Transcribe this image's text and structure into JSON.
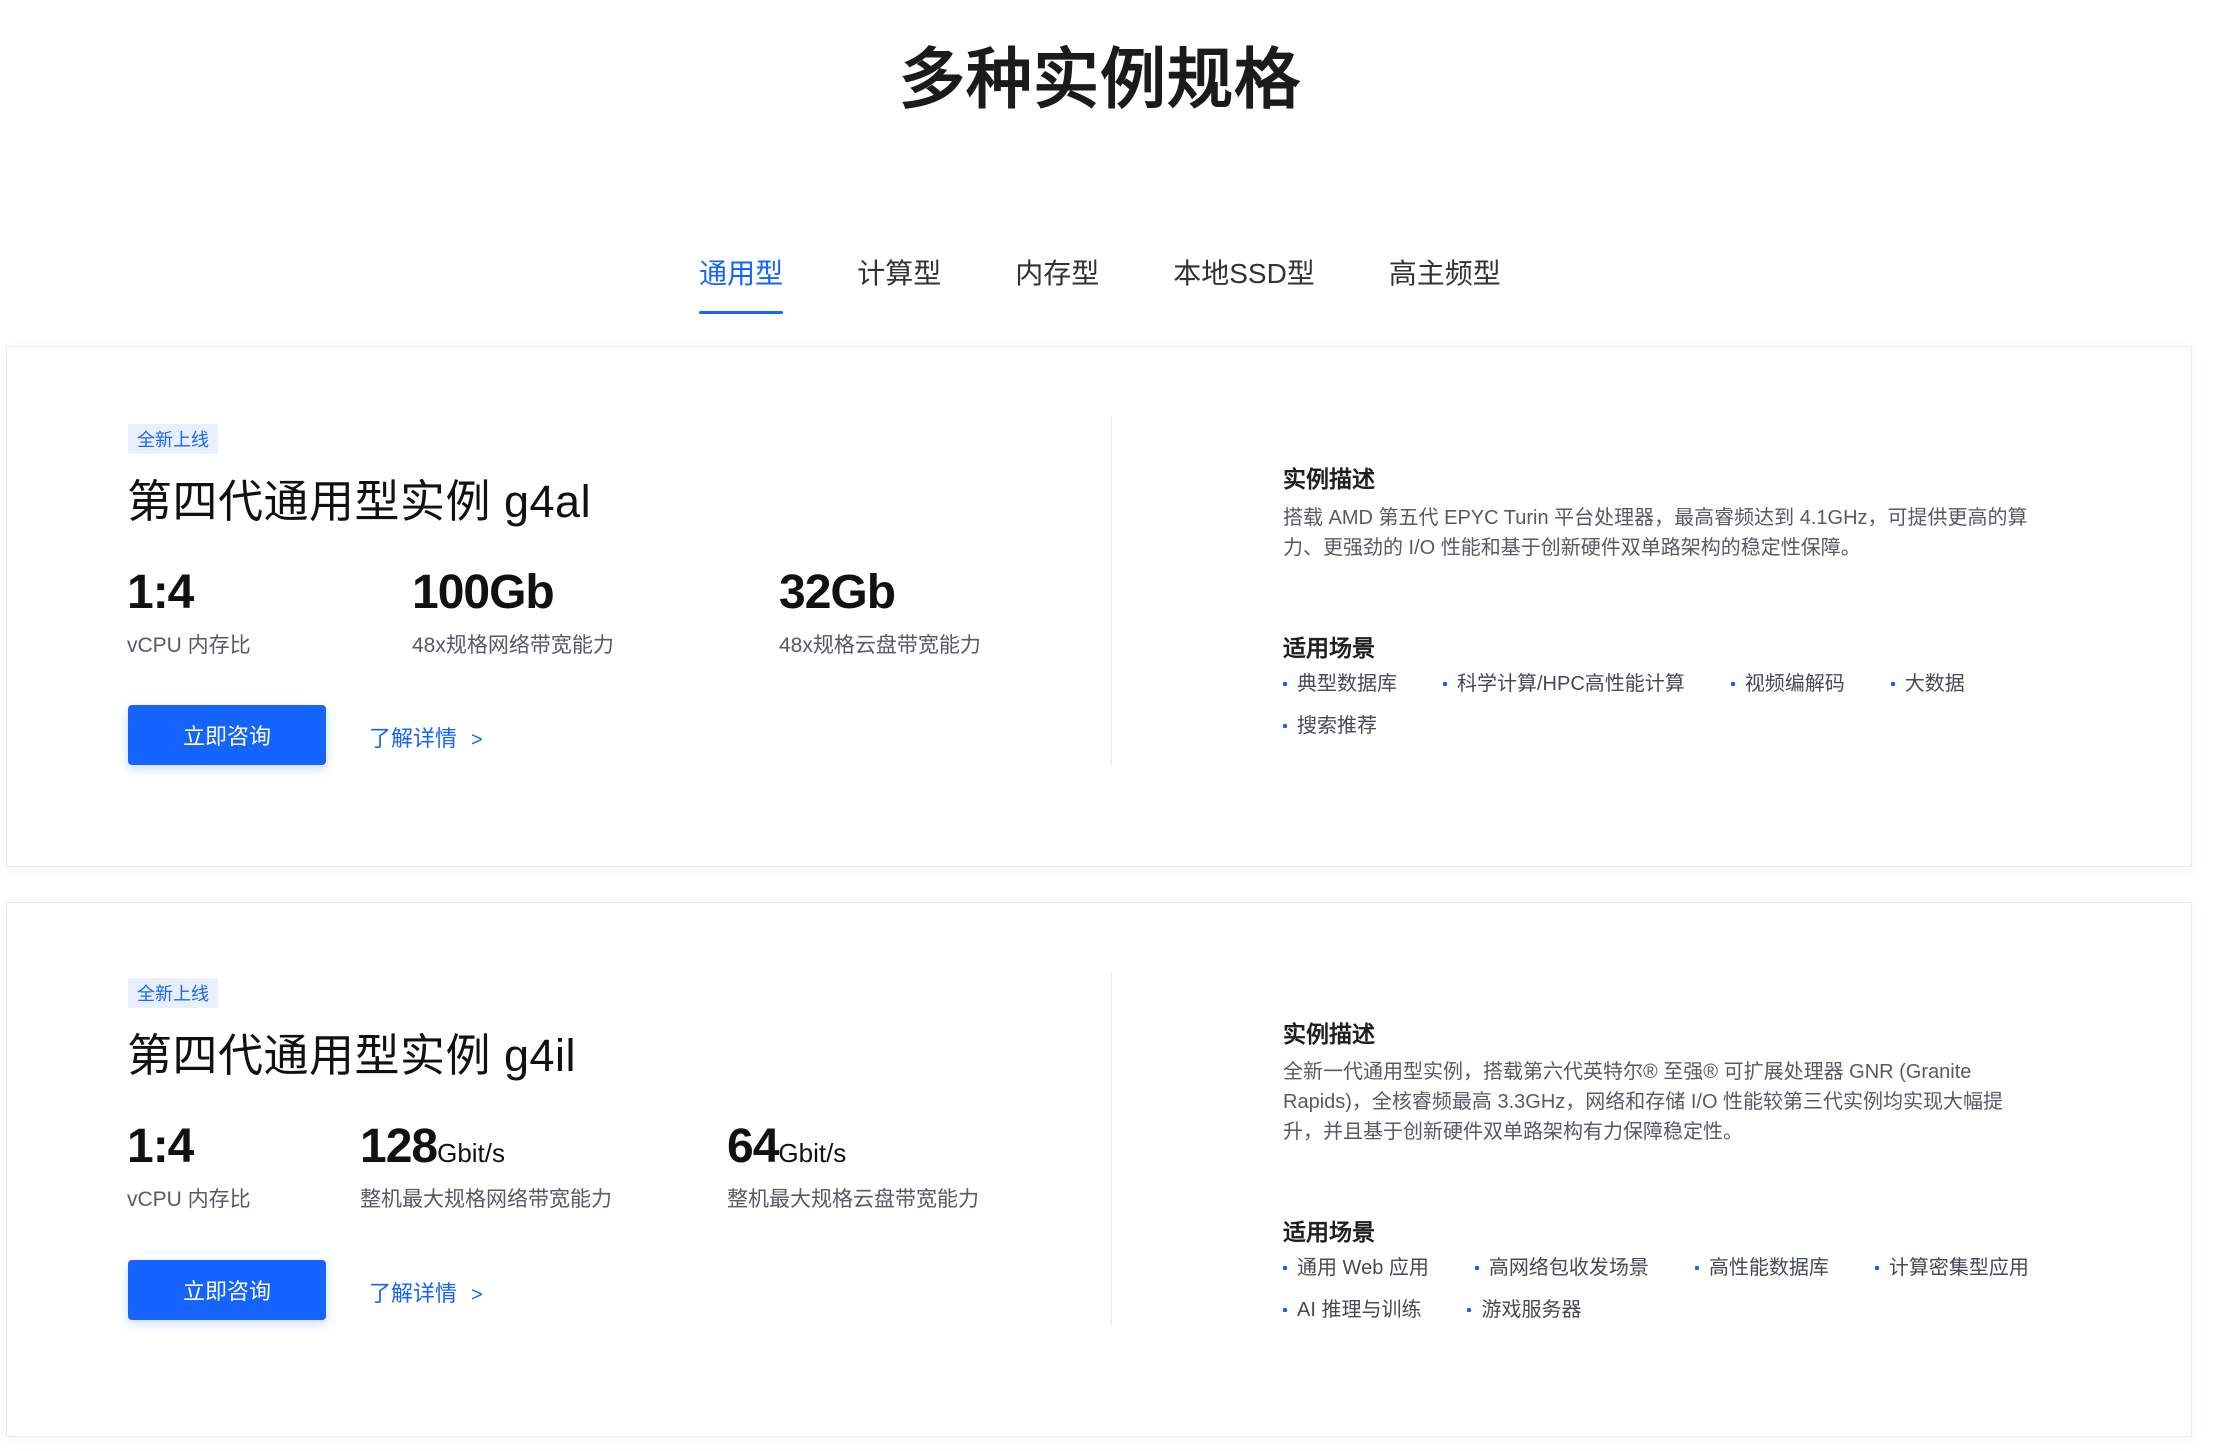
{
  "page_title": "多种实例规格",
  "tabs": [
    {
      "label": "通用型",
      "active": true
    },
    {
      "label": "计算型",
      "active": false
    },
    {
      "label": "内存型",
      "active": false
    },
    {
      "label": "本地SSD型",
      "active": false
    },
    {
      "label": "高主频型",
      "active": false
    }
  ],
  "cards": [
    {
      "badge": "全新上线",
      "title": "第四代通用型实例 g4al",
      "stats": [
        {
          "value": "1:4",
          "unit": "",
          "label": "vCPU 内存比"
        },
        {
          "value": "100Gb",
          "unit": "",
          "label": "48x规格网络带宽能力"
        },
        {
          "value": "32Gb",
          "unit": "",
          "label": "48x规格云盘带宽能力"
        }
      ],
      "consult_label": "立即咨询",
      "more_label": "了解详情",
      "more_arrow": ">",
      "desc_title": "实例描述",
      "desc_text": "搭载 AMD 第五代 EPYC Turin 平台处理器，最高睿频达到 4.1GHz，可提供更高的算力、更强劲的 I/O 性能和基于创新硬件双单路架构的稳定性保障。",
      "scene_title": "适用场景",
      "scenes": [
        "典型数据库",
        "科学计算/HPC高性能计算",
        "视频编解码",
        "大数据",
        "搜索推荐"
      ]
    },
    {
      "badge": "全新上线",
      "title": "第四代通用型实例 g4il",
      "stats": [
        {
          "value": "1:4",
          "unit": "",
          "label": "vCPU 内存比"
        },
        {
          "value": "128",
          "unit": "Gbit/s",
          "label": "整机最大规格网络带宽能力"
        },
        {
          "value": "64",
          "unit": "Gbit/s",
          "label": "整机最大规格云盘带宽能力"
        }
      ],
      "consult_label": "立即咨询",
      "more_label": "了解详情",
      "more_arrow": ">",
      "desc_title": "实例描述",
      "desc_text": "全新一代通用型实例，搭载第六代英特尔® 至强® 可扩展处理器 GNR (Granite Rapids)，全核睿频最高 3.3GHz，网络和存储 I/O 性能较第三代实例均实现大幅提升，并且基于创新硬件双单路架构有力保障稳定性。",
      "scene_title": "适用场景",
      "scenes": [
        "通用 Web 应用",
        "高网络包收发场景",
        "高性能数据库",
        "计算密集型应用",
        "AI 推理与训练",
        "游戏服务器"
      ]
    }
  ],
  "colors": {
    "accent": "#1664ff",
    "badge_bg": "#e8efff",
    "text_primary": "#111111",
    "text_secondary": "#555a66"
  }
}
